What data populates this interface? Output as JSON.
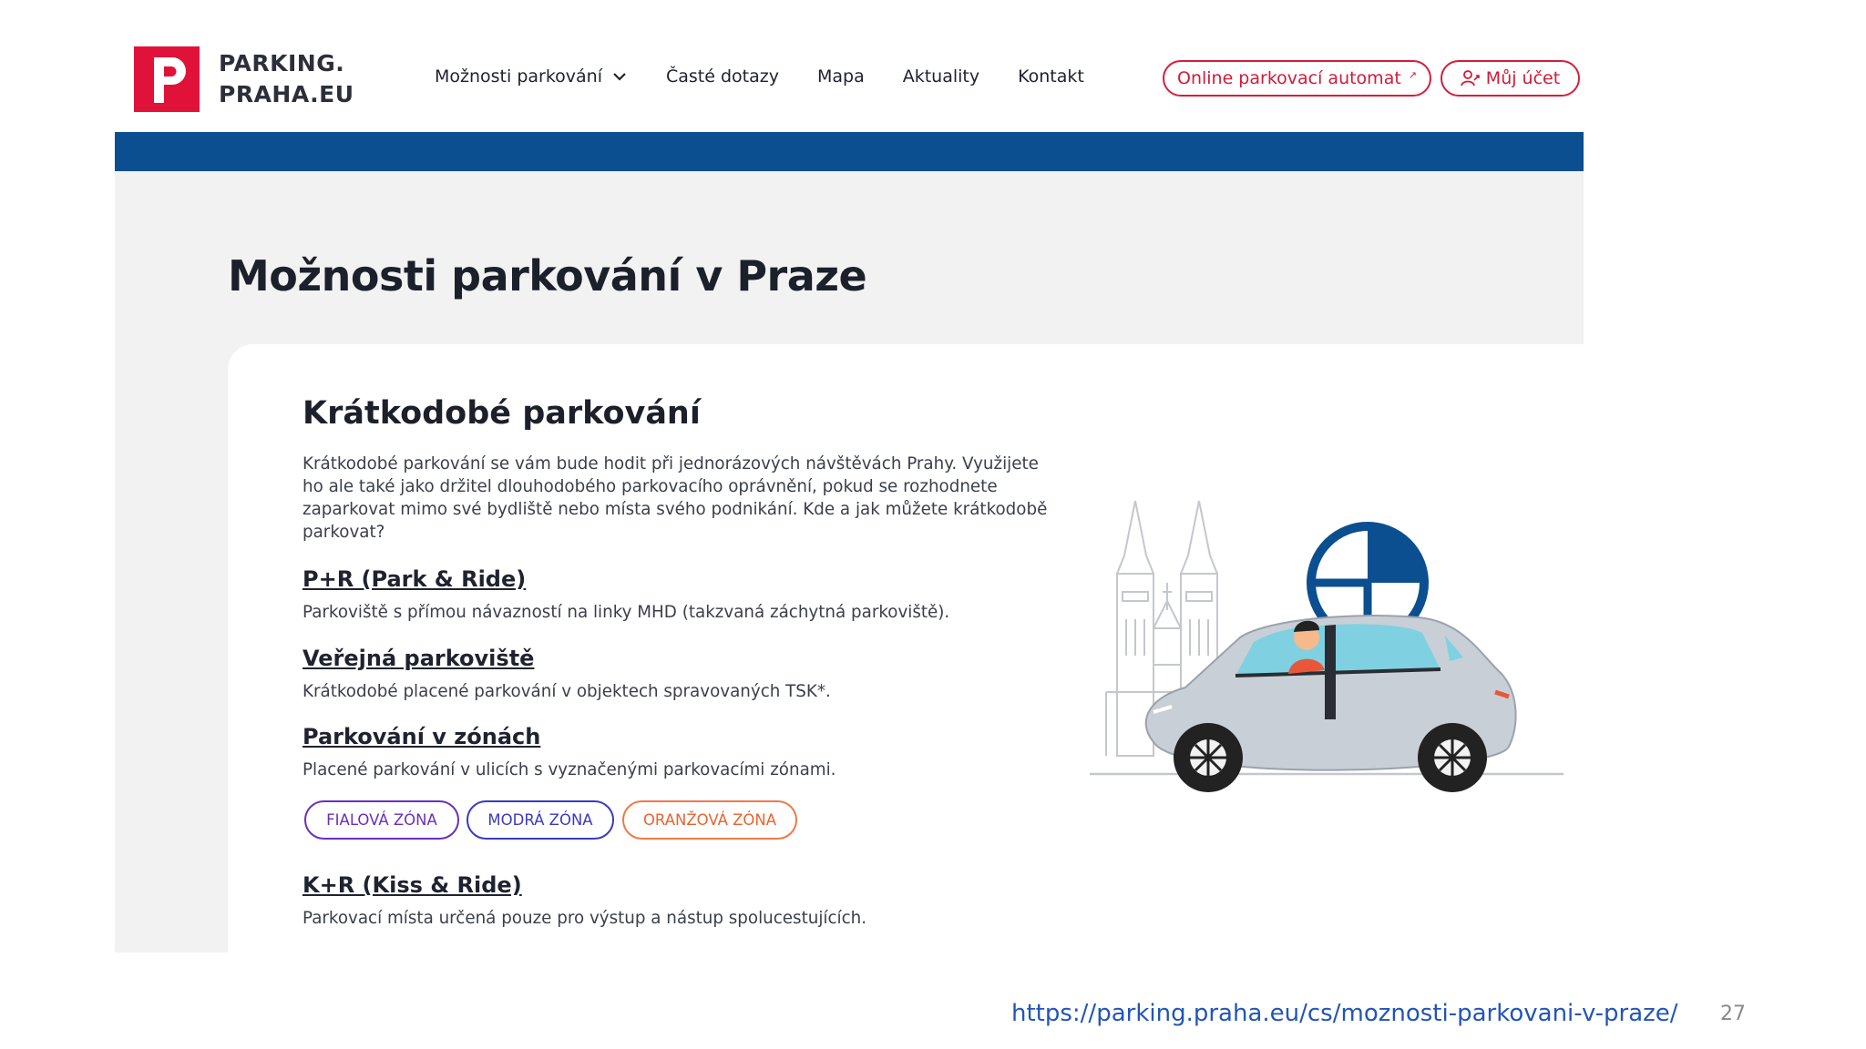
{
  "header": {
    "logo_letter": "P",
    "logo_line1": "PARKING.",
    "logo_line2": "PRAHA.EU",
    "brand_color": "#e0123a",
    "nav": [
      {
        "label": "Možnosti parkování",
        "has_dropdown": true
      },
      {
        "label": "Časté dotazy"
      },
      {
        "label": "Mapa"
      },
      {
        "label": "Aktuality"
      },
      {
        "label": "Kontakt"
      }
    ],
    "automat_label": "Online parkovací automat",
    "automat_icon": "external-link-icon",
    "account_label": "Můj účet",
    "account_icon": "user-icon",
    "accent_color": "#d61d3b",
    "bar_color": "#0b4f90"
  },
  "page": {
    "title": "Možnosti parkování v Praze"
  },
  "section": {
    "title": "Krátkodobé parkování",
    "intro": "Krátkodobé parkování se vám bude hodit při jednorázových návštěvách Prahy. Využijete ho ale také jako držitel dlouhodobého parkovacího oprávnění, pokud se rozhodnete zaparkovat mimo své bydliště nebo místa svého podnikání. Kde a jak můžete krátkodobě parkovat?",
    "options": [
      {
        "title": "P+R (Park & Ride)",
        "desc": "Parkoviště s přímou návazností na linky MHD (takzvaná záchytná parkoviště)."
      },
      {
        "title": "Veřejná parkoviště",
        "desc": "Krátkodobé placené parkování v objektech spravovaných TSK*."
      },
      {
        "title": "Parkování v zónách",
        "desc": "Placené parkování v ulicích s vyznačenými parkovacími zónami."
      },
      {
        "title": "K+R (Kiss & Ride)",
        "desc": "Parkovací místa určená pouze pro výstup a nástup spolucestujících."
      }
    ],
    "zones": [
      {
        "label": "FIALOVÁ ZÓNA",
        "color": "#6a2fbf"
      },
      {
        "label": "MODRÁ ZÓNA",
        "color": "#3a3bc0"
      },
      {
        "label": "ORANŽOVÁ ZÓNA",
        "color": "#f0794a"
      }
    ],
    "illustration": "car-with-clock-and-tyn-church-illustration"
  },
  "footer": {
    "url": "https://parking.praha.eu/cs/moznosti-parkovani-v-praze/",
    "page_number": "27"
  }
}
